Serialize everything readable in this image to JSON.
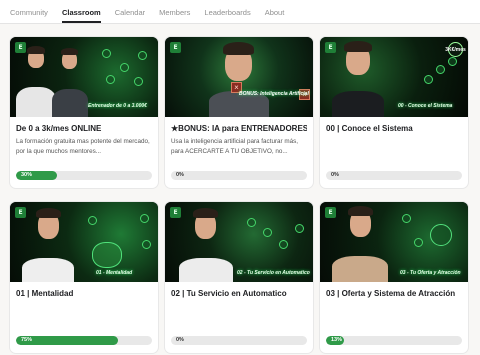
{
  "nav": {
    "tabs": [
      {
        "label": "Community"
      },
      {
        "label": "Classroom",
        "active": true
      },
      {
        "label": "Calendar"
      },
      {
        "label": "Members"
      },
      {
        "label": "Leaderboards"
      },
      {
        "label": "About"
      }
    ]
  },
  "logo_letter": "E",
  "courses": [
    {
      "title": "De 0 a 3k/mes ONLINE",
      "description": "La formación gratuita mas potente del mercado, por la que muchos mentores...",
      "progress": 30,
      "progress_label": "30%",
      "thumb_caption": "Entrenador de 0 a 3.000€"
    },
    {
      "title": "★BONUS: IA para ENTRENADORES",
      "description": "Usa la inteligencia artificial para facturar más, para ACERCARTE A TU OBJETIVO, no...",
      "progress": 0,
      "progress_label": "0%",
      "thumb_caption": "BONUS: Inteligencia Artificial"
    },
    {
      "title": "00 | Conoce el Sistema",
      "description": "",
      "progress": 0,
      "progress_label": "0%",
      "thumb_caption": "00 - Conoce el Sistema",
      "thumb_badge": "3K€/mes"
    },
    {
      "title": "01 | Mentalidad",
      "description": "",
      "progress": 75,
      "progress_label": "75%",
      "thumb_caption": "01 - Mentalidad"
    },
    {
      "title": "02 | Tu Servicio en Automatico",
      "description": "",
      "progress": 0,
      "progress_label": "0%",
      "thumb_caption": "02 - Tu Servicio en Automatico"
    },
    {
      "title": "03 | Oferta y Sistema de Atracción",
      "description": "",
      "progress": 13,
      "progress_label": "13%",
      "thumb_caption": "03 - Tu Oferta y Atracción"
    }
  ],
  "colors": {
    "progress_fill": "#2f9a48",
    "progress_track": "#e8e8e8",
    "thumb_glow": "#2bff6a"
  }
}
